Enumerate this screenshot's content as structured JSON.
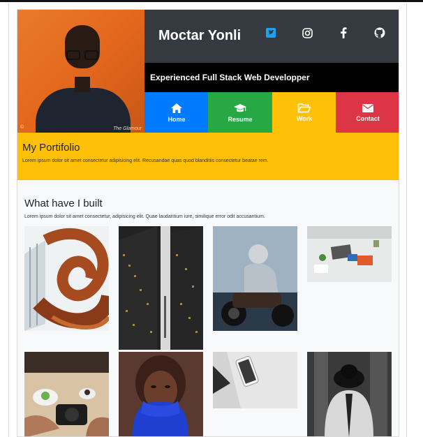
{
  "header": {
    "name": "Moctar Yonli",
    "tagline": "Experienced Full Stack Web Developper",
    "photo_watermark": "The Glamour",
    "photo_watermark_left": "©"
  },
  "social": [
    {
      "icon": "twitter-icon"
    },
    {
      "icon": "instagram-icon"
    },
    {
      "icon": "facebook-icon"
    },
    {
      "icon": "github-icon"
    }
  ],
  "nav": [
    {
      "label": "Home",
      "icon": "home-icon",
      "color": "#007bff"
    },
    {
      "label": "Resume",
      "icon": "graduation-cap-icon",
      "color": "#28a745"
    },
    {
      "label": "Work",
      "icon": "folder-open-icon",
      "color": "#ffc107"
    },
    {
      "label": "Contact",
      "icon": "envelope-icon",
      "color": "#dc3545"
    }
  ],
  "portfolio": {
    "title": "My Portifolio",
    "text": "Lorem ipsum dolor sit amet consectetur adipisicing elit. Recusandae quas quod blanditiis consectetur beatae rem."
  },
  "built": {
    "title": "What have I built",
    "text": "Lorem ipsum dolor sit amet consectetur, adipisicing elit. Quae laudantium iure, similique error odit accusantium."
  },
  "gallery": [
    {
      "subject": "spiral-staircase-image"
    },
    {
      "subject": "skyscrapers-image"
    },
    {
      "subject": "motorcyclist-image"
    },
    {
      "subject": "desk-workspace-image"
    },
    {
      "subject": "camera-cafe-image"
    },
    {
      "subject": "woman-blue-sweater-image"
    },
    {
      "subject": "phone-laptop-image"
    },
    {
      "subject": "man-hat-image"
    }
  ]
}
